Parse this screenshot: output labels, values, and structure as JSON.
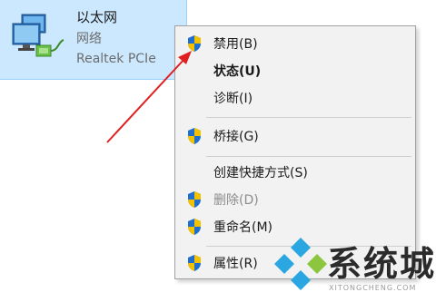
{
  "adapter": {
    "name": "以太网",
    "status": "网络",
    "device": "Realtek PCIe"
  },
  "context_menu": {
    "items": [
      {
        "label": "禁用(B)",
        "shield": true,
        "bold": false,
        "disabled": false
      },
      {
        "label": "状态(U)",
        "shield": false,
        "bold": true,
        "disabled": false
      },
      {
        "label": "诊断(I)",
        "shield": false,
        "bold": false,
        "disabled": false
      },
      {
        "label": "桥接(G)",
        "shield": true,
        "bold": false,
        "disabled": false
      },
      {
        "label": "创建快捷方式(S)",
        "shield": false,
        "bold": false,
        "disabled": false
      },
      {
        "label": "删除(D)",
        "shield": true,
        "bold": false,
        "disabled": true
      },
      {
        "label": "重命名(M)",
        "shield": true,
        "bold": false,
        "disabled": false
      },
      {
        "label": "属性(R)",
        "shield": true,
        "bold": false,
        "disabled": false
      }
    ]
  },
  "watermark": {
    "brand": "系统城",
    "url": "XITONGCHENG.COM"
  },
  "colors": {
    "selection": "#cce8ff",
    "menu_bg": "#f2f2f2",
    "arrow": "#e02020",
    "shield_blue": "#1f6fd0",
    "shield_yellow": "#f2c200"
  }
}
